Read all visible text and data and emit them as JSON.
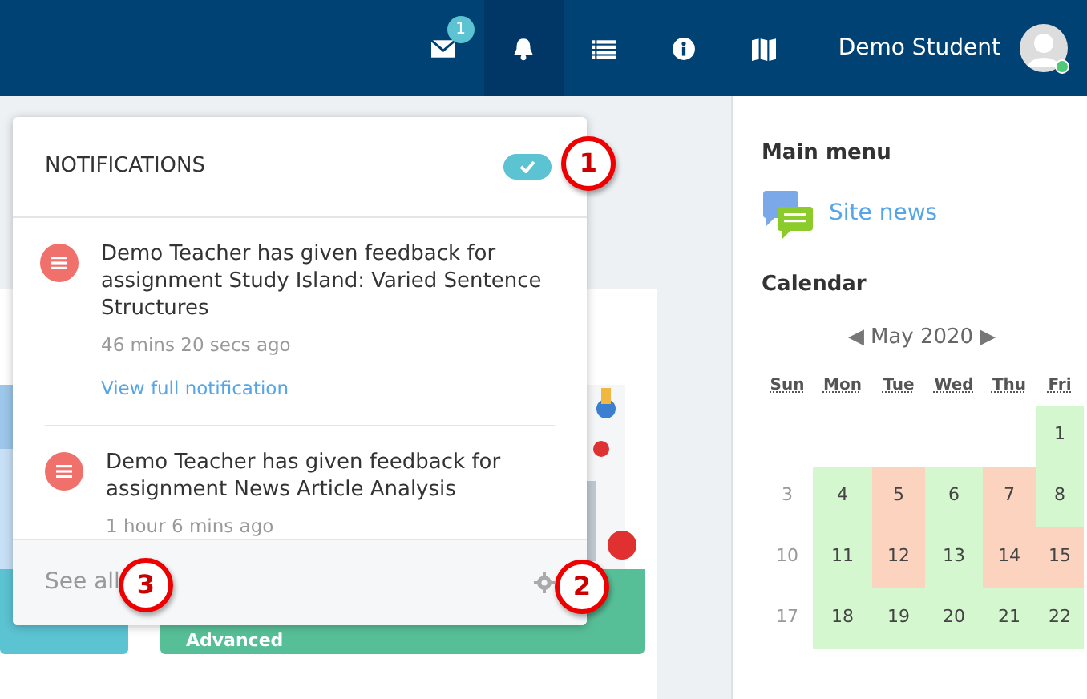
{
  "navbar": {
    "items": [
      {
        "badge": "1",
        "selected": false
      },
      {
        "selected": true
      },
      {
        "selected": false
      },
      {
        "selected": false
      },
      {
        "selected": false
      }
    ],
    "user": {
      "name": "Demo Student",
      "online": true
    }
  },
  "main": {
    "tiles": [
      {
        "color": "#5bc3d2"
      },
      {
        "label": "Advanced",
        "color": "#57bf97"
      }
    ]
  },
  "notifications": {
    "title": "NOTIFICATIONS",
    "toggle_on": true,
    "items": [
      {
        "text": "Demo Teacher has given feedback for assignment Study Island: Varied Sentence Structures",
        "time": "46 mins 20 secs ago",
        "link": "View full notification"
      },
      {
        "text": "Demo Teacher has given feedback for assignment News Article Analysis",
        "time": "1 hour 6 mins ago"
      }
    ],
    "footer": {
      "see_all": "See all"
    }
  },
  "callouts": [
    "1",
    "2",
    "3"
  ],
  "sidebar": {
    "main_menu": {
      "title": "Main menu",
      "items": [
        "Site news"
      ]
    },
    "calendar": {
      "title": "Calendar",
      "prev": "◀",
      "month": "May 2020",
      "next": "▶",
      "weekdays": [
        "Sun",
        "Mon",
        "Tue",
        "Wed",
        "Thu",
        "Fri"
      ],
      "weeks": [
        [
          {
            "day": "1",
            "color": "#d5f7cf"
          }
        ],
        [
          {
            "day": "3"
          },
          {
            "day": "4",
            "color": "#d5f7cf"
          },
          {
            "day": "5",
            "color": "#fcd3bf"
          },
          {
            "day": "6",
            "color": "#d5f7cf"
          },
          {
            "day": "7",
            "color": "#fcd3bf"
          },
          {
            "day": "8",
            "color": "#d5f7cf"
          }
        ],
        [
          {
            "day": "10"
          },
          {
            "day": "11",
            "color": "#d5f7cf"
          },
          {
            "day": "12",
            "color": "#fcd3bf"
          },
          {
            "day": "13",
            "color": "#d5f7cf"
          },
          {
            "day": "14",
            "color": "#fcd3bf"
          },
          {
            "day": "15",
            "color": "#fcd3bf"
          }
        ],
        [
          {
            "day": "17"
          },
          {
            "day": "18",
            "color": "#d5f7cf"
          },
          {
            "day": "19",
            "color": "#d5f7cf"
          },
          {
            "day": "20",
            "color": "#d5f7cf"
          },
          {
            "day": "21",
            "color": "#d5f7cf"
          },
          {
            "day": "22",
            "color": "#d5f7cf"
          }
        ]
      ]
    }
  }
}
